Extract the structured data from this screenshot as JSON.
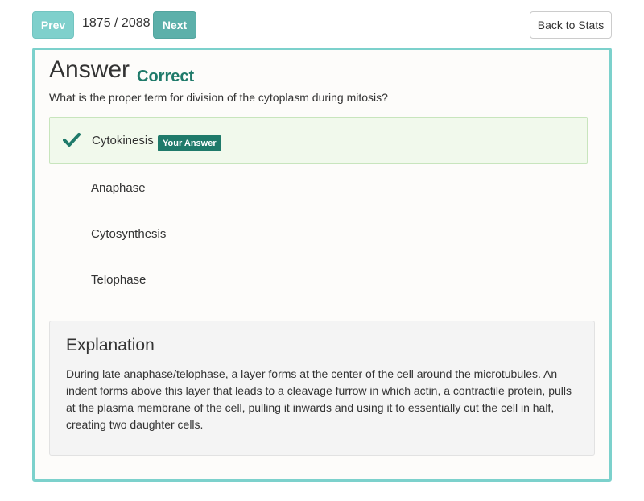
{
  "nav": {
    "prev_label": "Prev",
    "counter": "1875 / 2088",
    "next_label": "Next",
    "back_label": "Back to Stats"
  },
  "answer": {
    "title": "Answer",
    "verdict": "Correct",
    "question": "What is the proper term for division of the cytoplasm during mitosis?",
    "options": [
      {
        "label": "Cytokinesis",
        "selected": true,
        "badge": "Your Answer"
      },
      {
        "label": "Anaphase"
      },
      {
        "label": "Cytosynthesis"
      },
      {
        "label": "Telophase"
      }
    ]
  },
  "explanation": {
    "title": "Explanation",
    "body": "During late anaphase/telophase, a layer forms at the center of the cell around the microtubules. An indent forms above this layer that leads to a cleavage furrow in which actin, a contractile protein, pulls at the plasma membrane of the cell, pulling it inwards and using it to essentially cut the cell in half, creating two daughter cells."
  },
  "colors": {
    "accent": "#7cd1cc",
    "correct": "#1f7a6a",
    "selected_bg": "#f1f9ec"
  },
  "icons": {
    "check": "check-icon"
  }
}
